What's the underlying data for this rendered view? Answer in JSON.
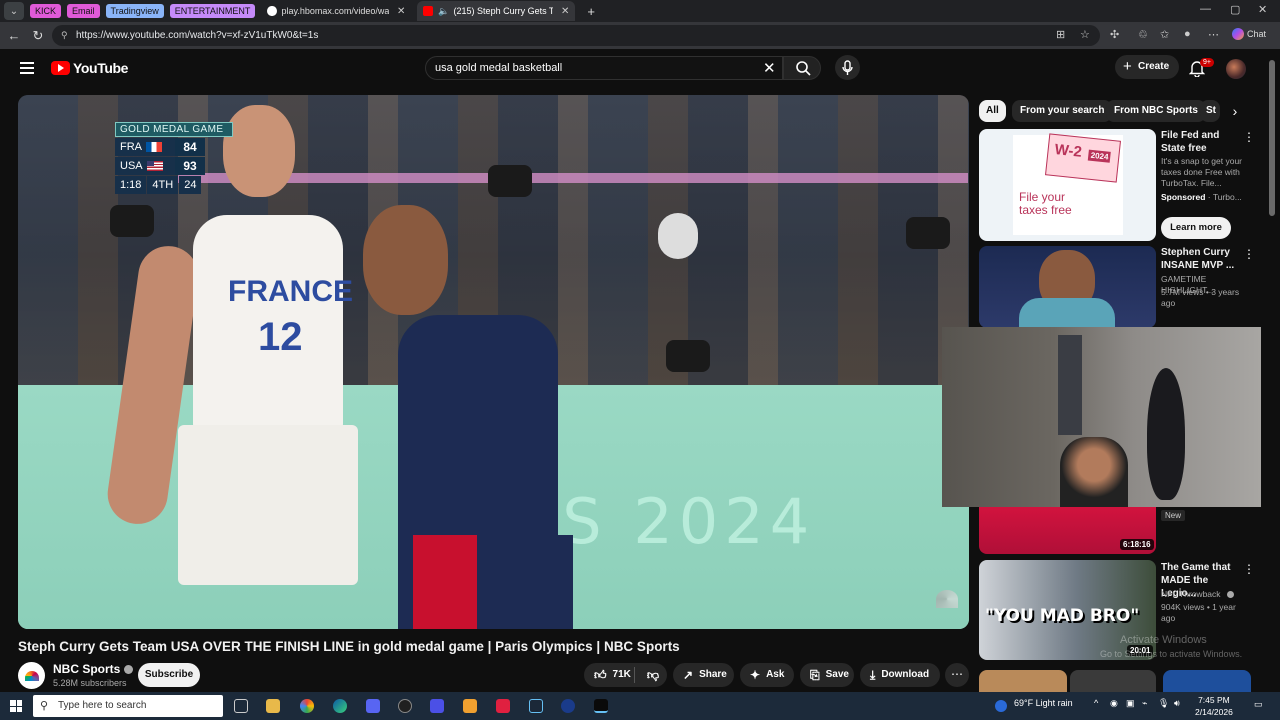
{
  "browser": {
    "tab_groups": [
      {
        "label": "KICK",
        "color": "#e05ad8"
      },
      {
        "label": "Email",
        "color": "#e05ad8"
      },
      {
        "label": "Tradingview",
        "color": "#8ab4f8"
      },
      {
        "label": "ENTERTAINMENT",
        "color": "#c58af9"
      }
    ],
    "tabs": [
      {
        "title": "play.hbomax.com/video/watch/6...",
        "active": false
      },
      {
        "title": "(215) Steph Curry Gets Team...",
        "active": true
      }
    ],
    "url": "https://www.youtube.com/watch?v=xf-zV1uTkW0&t=1s",
    "chat_label": "Chat"
  },
  "youtube": {
    "logo_text": "YouTube",
    "search_query": "usa gold medal basketball",
    "create_label": "Create",
    "notification_count": "9+"
  },
  "player": {
    "scorebug": {
      "title": "GOLD MEDAL GAME",
      "teams": [
        {
          "abbr": "FRA",
          "score": "84"
        },
        {
          "abbr": "USA",
          "score": "93"
        }
      ],
      "clock": "1:18",
      "period": "4TH",
      "shot_clock": "24"
    },
    "jersey_text": "FRANCE",
    "jersey_number": "12",
    "board_text": "IS 2024"
  },
  "video": {
    "title": "Steph Curry Gets Team USA OVER THE FINISH LINE in gold medal game | Paris Olympics | NBC Sports",
    "channel": "NBC Sports",
    "subscribers": "5.28M subscribers",
    "subscribe_label": "Subscribe",
    "likes": "71K",
    "share_label": "Share",
    "ask_label": "Ask",
    "save_label": "Save",
    "download_label": "Download"
  },
  "chips": [
    "All",
    "From your search",
    "From NBC Sports",
    "St"
  ],
  "sidebar": {
    "ad": {
      "thumb_badge": "W-2",
      "thumb_year": "2024",
      "thumb_headline": "File your taxes free",
      "title": "File Fed and State free",
      "description": "It's a snap to get your taxes done Free with TurboTax. File...",
      "sponsor": "Sponsored",
      "sponsor_name": "Turbo...",
      "cta": "Learn more"
    },
    "items": [
      {
        "title": "Stephen Curry INSANE MVP ...",
        "channel": "GAMETIME HIGHLIGHT...",
        "meta": "5.7M views • 3 years ago"
      },
      {
        "badge": "New",
        "duration": "6:18:16"
      },
      {
        "title": "The Game that MADE the Legio...",
        "channel": "NFL Throwback",
        "meta": "904K views • 1 year ago",
        "duration": "20:01",
        "thumb_text": "\"YOU MAD BRO\""
      }
    ]
  },
  "watermark": {
    "line1": "Activate Windows",
    "line2": "Go to Settings to activate Windows."
  },
  "taskbar": {
    "search_placeholder": "Type here to search",
    "weather": "69°F  Light rain",
    "time": "7:45 PM",
    "date": "2/14/2026"
  }
}
